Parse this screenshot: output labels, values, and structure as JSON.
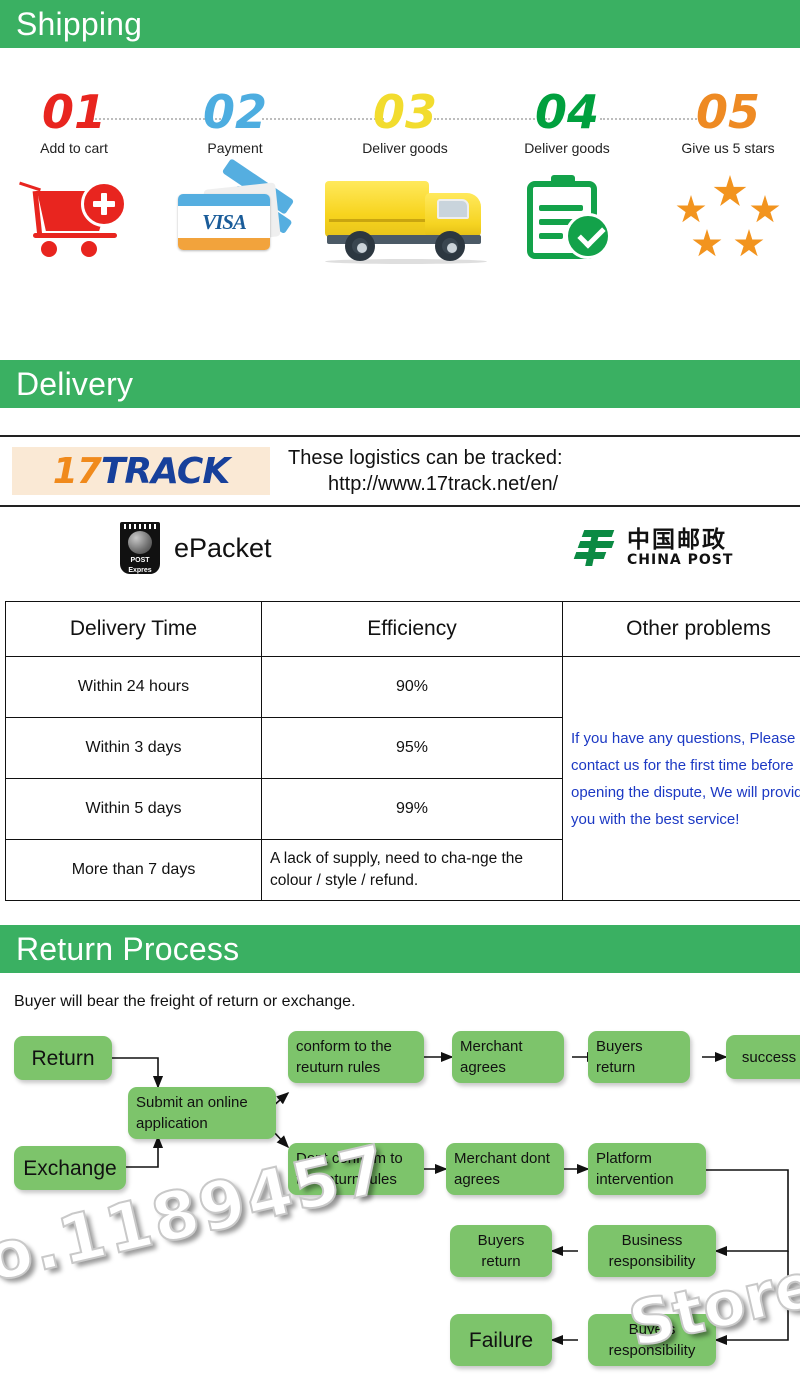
{
  "sections": {
    "shipping_title": "Shipping",
    "delivery_title": "Delivery",
    "return_title": "Return Process"
  },
  "colors": {
    "header_green": "#3AB062",
    "node_green": "#7DC46B",
    "step1": "#E8251F",
    "step2": "#4DADE0",
    "step3": "#F2DC2E",
    "step4": "#00A03E",
    "step5": "#EE8A23",
    "note_blue": "#1C39C4",
    "track_logo_bg": "#FAE9D5",
    "track_orange": "#F08A1C",
    "track_blue": "#17409B"
  },
  "steps": [
    {
      "num": "01",
      "caption": "Add to cart",
      "icon": "shopping-cart-icon"
    },
    {
      "num": "02",
      "caption": "Payment",
      "icon": "visa-card-icon"
    },
    {
      "num": "03",
      "caption": "Deliver goods",
      "icon": "delivery-truck-icon"
    },
    {
      "num": "04",
      "caption": "Deliver goods",
      "icon": "clipboard-check-icon"
    },
    {
      "num": "05",
      "caption": "Give us 5 stars",
      "icon": "five-stars-icon"
    }
  ],
  "tracking": {
    "logo_part1": "17",
    "logo_part2": "TRACK",
    "line1": "These logistics can be tracked:",
    "line2": "http://www.17track.net/en/"
  },
  "carriers": {
    "epacket_label": "ePacket",
    "epacket_badge_line1": "POST",
    "epacket_badge_line2": "Expres",
    "chinapost_cn": "中国邮政",
    "chinapost_en": "CHINA POST"
  },
  "table": {
    "headers": [
      "Delivery Time",
      "Efficiency",
      "Other problems"
    ],
    "rows": [
      {
        "time": "Within 24 hours",
        "efficiency": "90%"
      },
      {
        "time": "Within 3 days",
        "efficiency": "95%"
      },
      {
        "time": "Within 5 days",
        "efficiency": "99%"
      },
      {
        "time": "More than 7 days",
        "efficiency": "A lack of supply, need to cha-nge the colour / style / refund."
      }
    ],
    "note": "If you have any questions, Please contact us for the first time before opening the dispute, We will provide you with the best service!"
  },
  "return": {
    "note": "Buyer will bear the freight of return or exchange.",
    "nodes": {
      "return": "Return",
      "exchange": "Exchange",
      "submit": "Submit an online application",
      "conform": "conform to the reuturn rules",
      "not_conform": "Dont conform to the return rules",
      "merchant_agrees": "Merchant agrees",
      "buyers_return_top": "Buyers return",
      "success": "success",
      "merchant_dont_agrees": "Merchant dont agrees",
      "platform": "Platform intervention",
      "business_resp": "Business responsibility",
      "buyers_return_mid": "Buyers return",
      "buyers_resp": "Buyers responsibility",
      "failure": "Failure"
    }
  },
  "watermarks": {
    "number": "o.1189457",
    "store": "Store"
  }
}
